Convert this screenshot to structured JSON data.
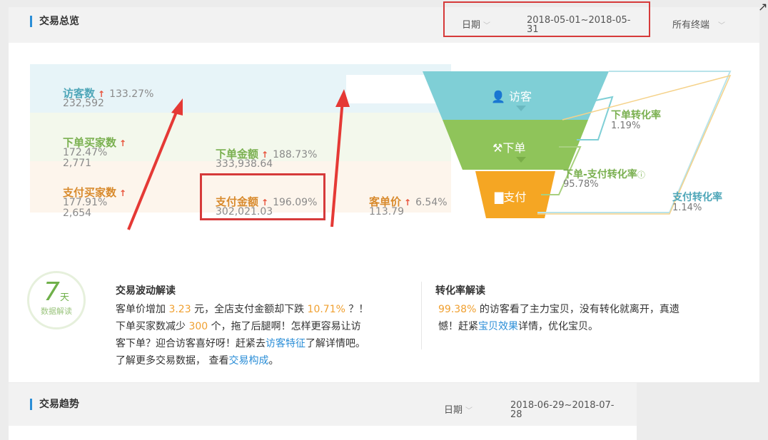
{
  "overview": {
    "title": "交易总览",
    "date_label": "日期",
    "date_range_line1": "2018-05-01~2018-05-",
    "date_range_line2": "31",
    "terminal_label": "所有终端"
  },
  "metrics": {
    "visitors": {
      "label": "访客数",
      "change": "133.27%",
      "value": "232,592"
    },
    "buyers": {
      "label": "下单买家数",
      "change": "172.47%",
      "value": "2,771"
    },
    "order_amount": {
      "label": "下单金额",
      "change": "188.73%",
      "value": "333,938.64"
    },
    "pay_buyers": {
      "label": "支付买家数",
      "change": "177.91%",
      "value": "2,654"
    },
    "pay_amount": {
      "label": "支付金额",
      "change": "196.09%",
      "value": "302,021.03"
    },
    "unit_price": {
      "label": "客单价",
      "change": "6.54%",
      "value": "113.79"
    }
  },
  "funnel": {
    "visit_label": "访客",
    "order_label": "下单",
    "pay_label": "支付",
    "order_rate_label": "下单转化率",
    "order_rate_value": "1.19%",
    "order_pay_rate_label": "下单-支付转化率",
    "order_pay_rate_value": "95.78%",
    "pay_rate_label": "支付转化率",
    "pay_rate_value": "1.14%"
  },
  "badge": {
    "number": "7",
    "unit": "天",
    "caption": "数据解读"
  },
  "trade_interp": {
    "title": "交易波动解读",
    "l1_a": "客单价增加 ",
    "l1_v1": "3.23",
    "l1_b": " 元，全店支付金额却下跌 ",
    "l1_v2": "10.71%",
    "l1_c": " ？！",
    "l2_a": "下单买家数减少 ",
    "l2_v": "300",
    "l2_b": " 个，拖了后腿啊！怎样更容易让访",
    "l3_a": "客下单？迎合访客喜好呀！赶紧去",
    "l3_link": "访客特征",
    "l3_b": "了解详情吧。",
    "l4_a": "了解更多交易数据，  查看",
    "l4_link": "交易构成",
    "l4_b": "。"
  },
  "conv_interp": {
    "title": "转化率解读",
    "l1_v": "99.38%",
    "l1_a": " 的访客看了主力宝贝，没有转化就离开，真遗",
    "l2_a": "憾！赶紧",
    "l2_link": "宝贝效果",
    "l2_b": "详情，优化宝贝。"
  },
  "trend": {
    "title": "交易趋势",
    "date_label": "日期",
    "date_range_line1": "2018-06-29~2018-07-",
    "date_range_line2": "28"
  },
  "colors": {
    "teal": "#7fcfd6",
    "green": "#8fc45a",
    "orange": "#f5a623",
    "annotation_red": "#d63a3a"
  }
}
